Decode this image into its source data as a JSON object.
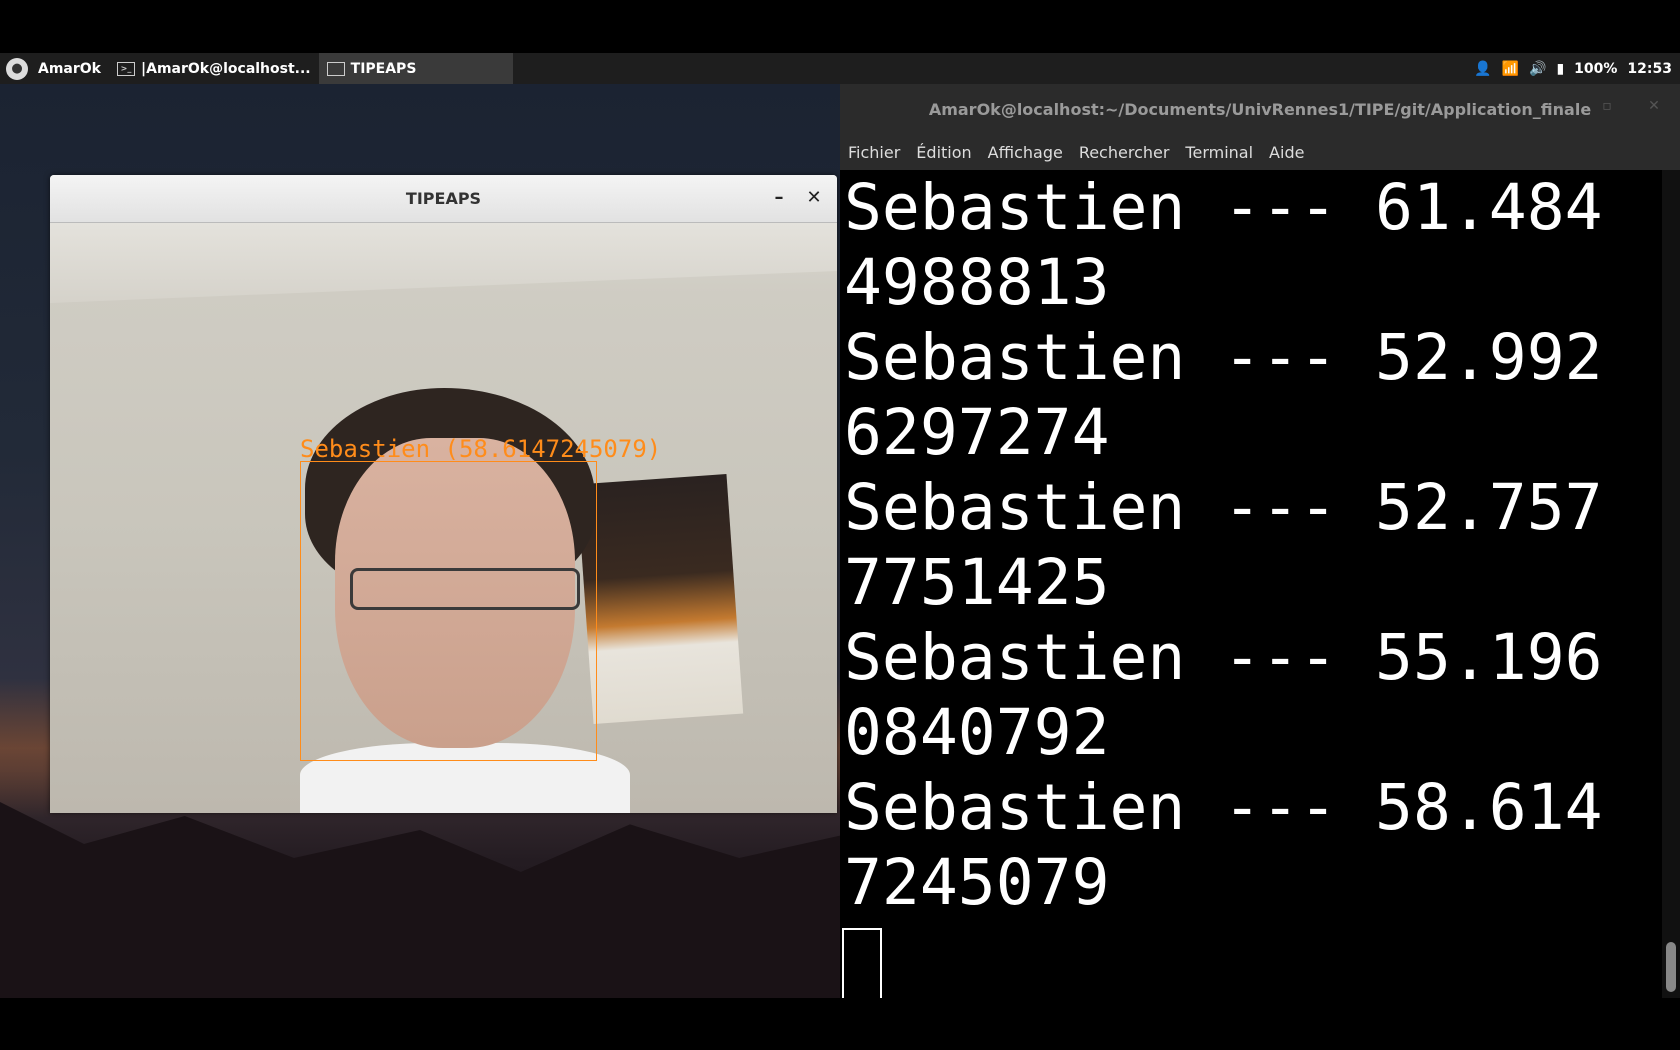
{
  "panel": {
    "launcher_label": "AmarOk",
    "tasks": [
      {
        "label": "|AmarOk@localhost..."
      },
      {
        "label": "TIPEAPS"
      }
    ],
    "battery": "100%",
    "clock": "12:53"
  },
  "tipeaps_window": {
    "title": "TIPEAPS",
    "minimize_label": "–",
    "close_label": "✕",
    "face_label": "Sebastien (58.6147245079)",
    "box_color": "#ff8c1a"
  },
  "terminal": {
    "title": "AmarOk@localhost:~/Documents/UnivRennes1/TIPE/git/Application_finale",
    "menu": [
      "Fichier",
      "Édition",
      "Affichage",
      "Rechercher",
      "Terminal",
      "Aide"
    ],
    "lines": [
      "Sebastien --- 61.484",
      "4988813",
      "Sebastien --- 52.992",
      "6297274",
      "Sebastien --- 52.757",
      "7751425",
      "Sebastien --- 55.196",
      "0840792",
      "Sebastien --- 58.614",
      "7245079"
    ]
  }
}
